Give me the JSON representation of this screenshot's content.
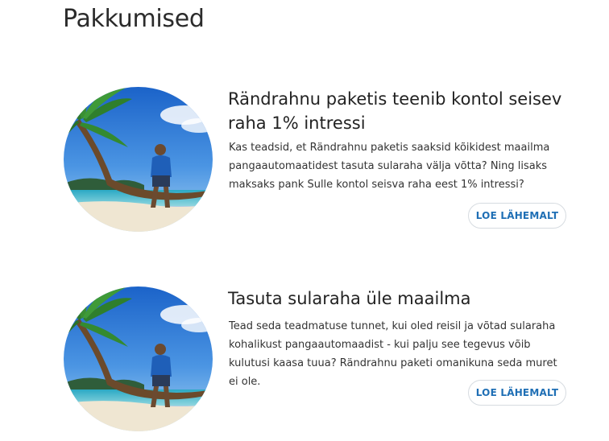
{
  "page": {
    "title": "Pakkumised"
  },
  "offers": [
    {
      "title": "Rändrahnu paketis teenib kontol seisev raha 1% intressi",
      "text": "Kas teadsid, et Rändrahnu paketis saaksid kõikidest maailma pangaautomaatidest tasuta sularaha välja võtta? Ning lisaks maksaks pank Sulle kontol seisva raha eest 1% intressi?",
      "button_label": "LOE LÄHEMALT",
      "image_icon": "palm-beach-traveler-photo"
    },
    {
      "title": "Tasuta sularaha üle maailma",
      "text": "Tead seda teadmatuse tunnet, kui oled reisil ja võtad sularaha kohalikust pangaautomaadist - kui palju see tegevus võib kulutusi kaasa tuua? Rändrahnu paketi omanikuna seda muret ei ole.",
      "button_label": "LOE LÄHEMALT",
      "image_icon": "palm-beach-traveler-photo"
    }
  ],
  "colors": {
    "accent": "#1f6fb5",
    "button_border": "#d6dbe0",
    "text": "#333333"
  }
}
